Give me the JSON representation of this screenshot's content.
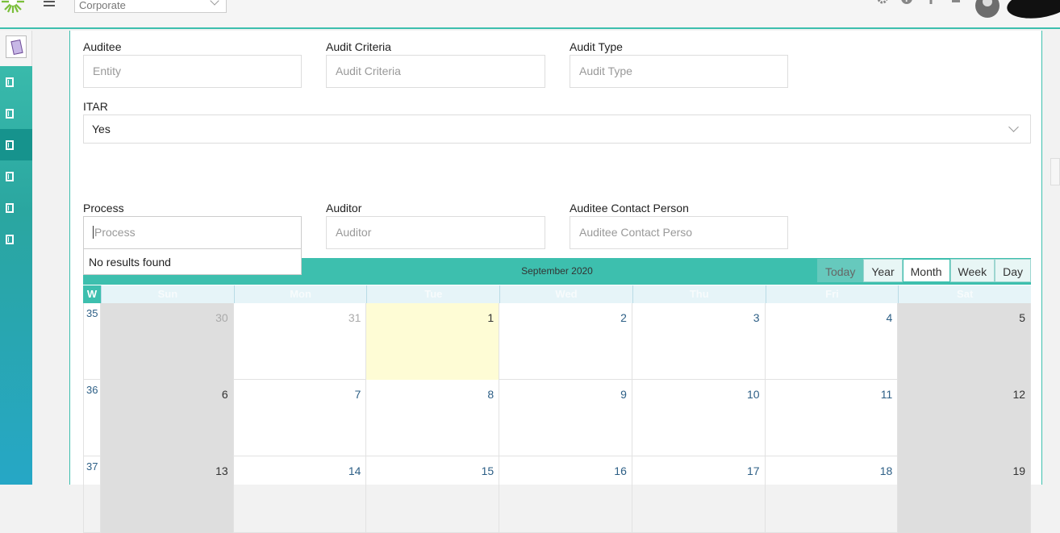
{
  "topbar": {
    "org_select": "Corporate",
    "icons": [
      "gear-icon",
      "help-icon",
      "plus-icon",
      "bell-icon"
    ]
  },
  "sidebar": {
    "items": [
      "building-icon",
      "building-icon",
      "building-icon",
      "building-icon",
      "building-icon",
      "building-icon"
    ],
    "active_index": 2
  },
  "form": {
    "auditee_label": "Auditee",
    "auditee_placeholder": "Entity",
    "audit_criteria_label": "Audit Criteria",
    "audit_criteria_placeholder": "Audit Criteria",
    "audit_type_label": "Audit Type",
    "audit_type_placeholder": "Audit Type",
    "itar_label": "ITAR",
    "itar_value": "Yes",
    "process_label": "Process",
    "process_placeholder": "Process",
    "auditor_label": "Auditor",
    "auditor_placeholder": "Auditor",
    "contact_label": "Auditee Contact Person",
    "contact_placeholder": "Auditee Contact Perso",
    "no_results": "No results found"
  },
  "calendar": {
    "title": "September 2020",
    "views": [
      "Today",
      "Year",
      "Month",
      "Week",
      "Day"
    ],
    "active_view": "Month",
    "week_header": "W",
    "days_of_week": [
      "Sun",
      "Mon",
      "Tue",
      "Wed",
      "Thu",
      "Fri",
      "Sat"
    ],
    "weeks": [
      {
        "num": "35",
        "days": [
          "30",
          "31",
          "1",
          "2",
          "3",
          "4",
          "5"
        ]
      },
      {
        "num": "36",
        "days": [
          "6",
          "7",
          "8",
          "9",
          "10",
          "11",
          "12"
        ]
      },
      {
        "num": "37",
        "days": [
          "13",
          "14",
          "15",
          "16",
          "17",
          "18",
          "19"
        ]
      }
    ],
    "today_date": "1"
  }
}
